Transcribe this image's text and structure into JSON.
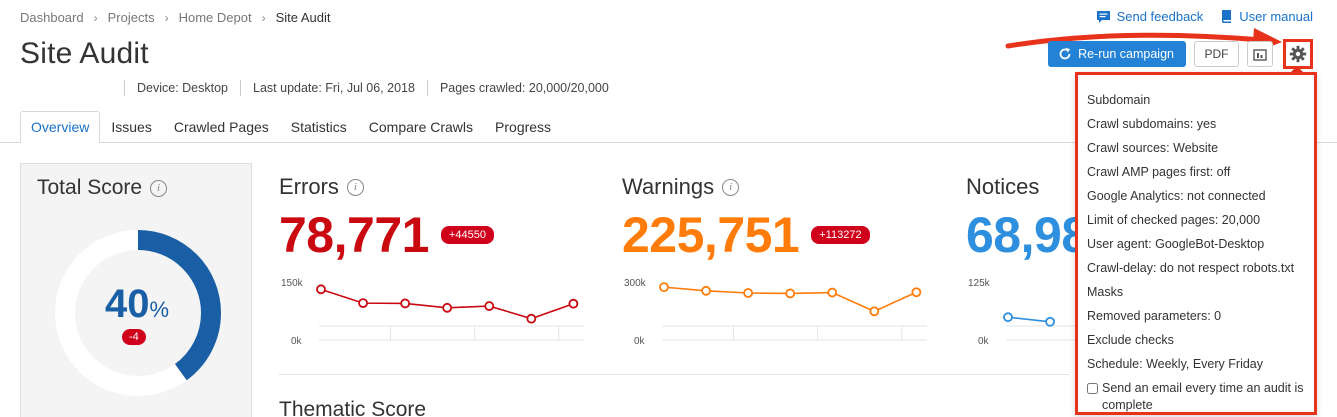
{
  "breadcrumb": [
    "Dashboard",
    "Projects",
    "Home Depot",
    "Site Audit"
  ],
  "header": {
    "title": "Site Audit",
    "send_feedback": "Send feedback",
    "user_manual": "User manual",
    "meta": {
      "device": "Device: Desktop",
      "last_update": "Last update: Fri, Jul 06, 2018",
      "pages_crawled": "Pages crawled: 20,000/20,000"
    }
  },
  "actions": {
    "rerun_label": "Re-run campaign",
    "pdf_label": "PDF"
  },
  "tabs": [
    "Overview",
    "Issues",
    "Crawled Pages",
    "Statistics",
    "Compare Crawls",
    "Progress"
  ],
  "active_tab": "Overview",
  "total_score": {
    "title": "Total Score",
    "value": "40",
    "unit": "%",
    "fraction": 0.4,
    "delta": "-4"
  },
  "metrics": {
    "errors": {
      "title": "Errors",
      "value": "78,771",
      "delta": "+44550",
      "color": "#c9080f",
      "ymax_label": "150k",
      "ymin_label": "0k",
      "ymax": 150000,
      "points": [
        125000,
        78000,
        77000,
        62000,
        68000,
        25000,
        76000
      ]
    },
    "warnings": {
      "title": "Warnings",
      "value": "225,751",
      "delta": "+113272",
      "color": "#ff7c0a",
      "ymax_label": "300k",
      "ymin_label": "0k",
      "ymax": 300000,
      "points": [
        265000,
        240000,
        225000,
        222000,
        228000,
        100000,
        230000
      ]
    },
    "notices": {
      "title": "Notices",
      "value": "68,98",
      "color": "#2e8fde",
      "ymax_label": "125k",
      "ymin_label": "0k",
      "ymax": 125000,
      "points": [
        25000,
        12000
      ]
    }
  },
  "thematic_title": "Thematic Score",
  "settings": {
    "items": [
      "Subdomain",
      "Crawl subdomains: yes",
      "Crawl sources: Website",
      "Crawl AMP pages first: off",
      "Google Analytics: not connected",
      "Limit of checked pages: 20,000",
      "User agent: GoogleBot-Desktop",
      "Crawl-delay: do not respect robots.txt",
      "Masks",
      "Removed parameters: 0",
      "Exclude checks",
      "Schedule: Weekly, Every Friday"
    ],
    "email_checkbox_label": "Send an email every time an audit is complete"
  },
  "colors": {
    "accent": "#2382d6",
    "highlight": "#e8321c",
    "score": "#1a5fa6"
  }
}
